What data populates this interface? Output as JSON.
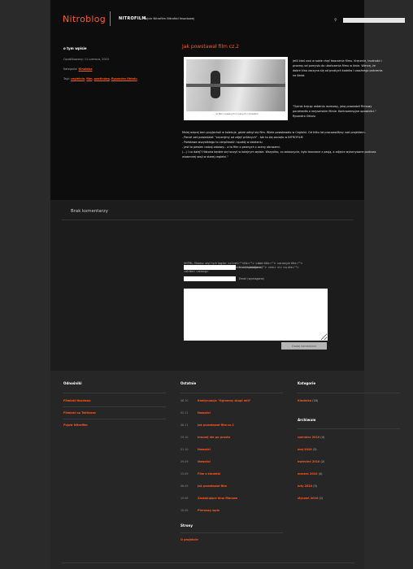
{
  "header": {
    "logo": "Nitroblog",
    "brand": "NITROFILM",
    "tagline": "Pojutr Nitrofilm Nitrofdd fesadowej",
    "search_placeholder": ""
  },
  "sidebar": {
    "title": "o tym wpisie",
    "published": "Opublikowany: 11 czerwca, 2010",
    "category_label": "Kategoria:",
    "category": "Kinoteka",
    "tags_label": "Tagi:",
    "tags": [
      "cegielnia",
      "film",
      "postindeg",
      "Rysondro Oktalu"
    ]
  },
  "post": {
    "title": "Jak powstawał film cz.2",
    "caption": "... to film o pewnych z ocenych z obrazami",
    "p1": "jeśli ktoś nosi w sobie chęć tworzenia filmu. Kręcenie, trudności i procesy od pomysłu do ukończenia filmu w kinie. Wierzę, że dobre kino zaczyna się od prostych kadrów i uważnego patrzenia na świat.",
    "p2": "\"Opinia kręcąc ostatnio rozmowy, jaką prowadził Filmowy porzekadło o reżyserskim filmie. Kontrowersyjne opowieści.\" Rysondro Oktalu",
    "p3": "Mniej więcej tam przyjechali w kolekcje, gdzie odbył się film. Wiele powstawało w Cegielni. Od kilku lat pracowaliśmy nad projektem.\n- Ponoć zaś powiedział: \"zacznijmy od zdjęć próbnych\" - tak to się zaczęło w NITROFILM\n- Podstawa wszystkiego to cierpliwość i spokój w działaniu\n- jest to pewien rodzaj zabawy... a to film o pewnych z oceny obrazami.\n(...) I co dalej? Historia będzie się toczyć w kolejnym wpisie. Wszystko, co zobaczycie, było tworzone z pasją, a zdjęcia wykonywane podczas wiosennej sesji w starej cegielni.\""
  },
  "comments": {
    "title": "Brak komentarzy",
    "note": "XHTML: Możesz użyć tych tagów: <a href=\"\" title=\"\"> <abbr title=\"\"> <acronym title=\"\"> <b> <blockquote cite=\"\"> <cite> <code> <del datetime=\"\"> <em> <i> <q cite=\"\"> <strike> <strong>",
    "name_label": "Nick (wymagane)",
    "email_label": "Email (wymagane)",
    "submit_label": "Dodaj komentarz"
  },
  "footer": {
    "friends_title": "Odnośniki",
    "friends": [
      "Filmiaki Nosdowa",
      "Filmiaki na Twitterze",
      "Pojutr Nitrofilm"
    ],
    "recent_title": "Ostatnie",
    "recent": [
      {
        "date": "06.10",
        "title": "Kontynuacja \"Ogromny skupi mili\""
      },
      {
        "date": "02.11",
        "title": "Nowości"
      },
      {
        "date": "06.11",
        "title": "Jak powstawał film cz.2"
      },
      {
        "date": "29.10",
        "title": "Inaczej nie po prostu"
      },
      {
        "date": "01.10",
        "title": "Nowości"
      },
      {
        "date": "29.09",
        "title": "Nowości"
      },
      {
        "date": "25.09",
        "title": "Film z kinoteki"
      },
      {
        "date": "06.09",
        "title": "Jak powstawał film"
      },
      {
        "date": "19.08",
        "title": "Zaskakujące kino filmowe"
      },
      {
        "date": "18.08",
        "title": "Pierwszy wpis"
      }
    ],
    "pages_title": "Strony",
    "pages": [
      "O projekcie"
    ],
    "categories_title": "Kategorie",
    "categories": [
      {
        "name": "Kinoteka",
        "count": "(18)"
      }
    ],
    "archive_title": "Archiwum",
    "archive": [
      {
        "name": "czerwiec 2010",
        "count": "(4)"
      },
      {
        "name": "maj 2010",
        "count": "(3)"
      },
      {
        "name": "kwiecień 2010",
        "count": "(2)"
      },
      {
        "name": "marzec 2010",
        "count": "(4)"
      },
      {
        "name": "luty 2010",
        "count": "(3)"
      },
      {
        "name": "styczeń 2010",
        "count": "(2)"
      }
    ]
  }
}
